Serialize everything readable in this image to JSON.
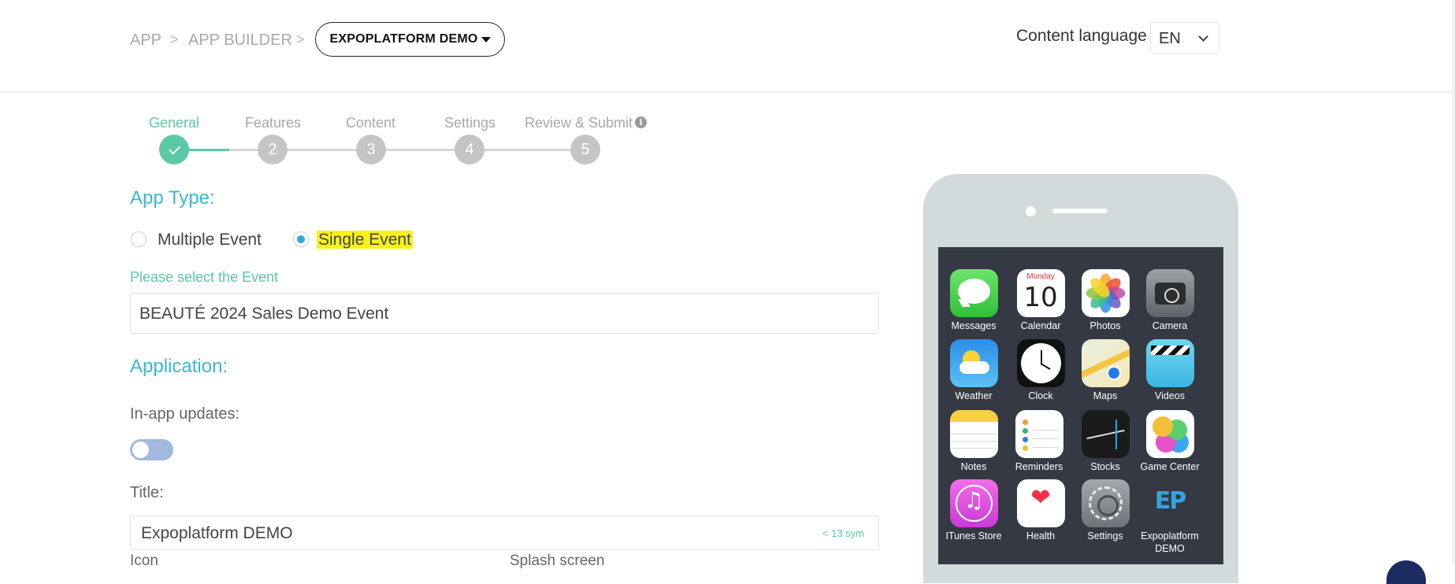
{
  "breadcrumb": {
    "items": [
      "APP",
      "APP BUILDER"
    ],
    "separator": ">",
    "event_selector": "EXPOPLATFORM DEMO"
  },
  "header": {
    "content_language_label": "Content language",
    "language_value": "EN"
  },
  "steps": [
    {
      "label": "General",
      "number": "1",
      "state": "done"
    },
    {
      "label": "Features",
      "number": "2",
      "state": "todo"
    },
    {
      "label": "Content",
      "number": "3",
      "state": "todo"
    },
    {
      "label": "Settings",
      "number": "4",
      "state": "todo"
    },
    {
      "label": "Review & Submit",
      "number": "5",
      "state": "todo"
    }
  ],
  "form": {
    "app_type_title": "App Type:",
    "radio_multiple": "Multiple Event",
    "radio_single": "Single Event",
    "selected_app_type": "Single Event",
    "select_event_label": "Please select the Event",
    "event_value": "BEAUTÉ 2024 Sales Demo Event",
    "application_title": "Application:",
    "inapp_updates_label": "In-app updates:",
    "inapp_updates_enabled": false,
    "title_label": "Title:",
    "title_value": "Expoplatform DEMO",
    "title_counter": "< 13 sym",
    "icon_label": "Icon",
    "splash_label": "Splash screen"
  },
  "phone_preview": {
    "apps": [
      {
        "label": "Messages",
        "icon": "messages-icon"
      },
      {
        "label": "Calendar",
        "icon": "calendar-icon",
        "day": "Monday",
        "date": "10"
      },
      {
        "label": "Photos",
        "icon": "photos-icon"
      },
      {
        "label": "Camera",
        "icon": "camera-icon"
      },
      {
        "label": "Weather",
        "icon": "weather-icon"
      },
      {
        "label": "Clock",
        "icon": "clock-icon"
      },
      {
        "label": "Maps",
        "icon": "maps-icon"
      },
      {
        "label": "Videos",
        "icon": "videos-icon"
      },
      {
        "label": "Notes",
        "icon": "notes-icon"
      },
      {
        "label": "Reminders",
        "icon": "reminders-icon"
      },
      {
        "label": "Stocks",
        "icon": "stocks-icon"
      },
      {
        "label": "Game Center",
        "icon": "game-center-icon"
      },
      {
        "label": "ITunes Store",
        "icon": "itunes-store-icon"
      },
      {
        "label": "Health",
        "icon": "health-icon"
      },
      {
        "label": "Settings",
        "icon": "settings-icon"
      },
      {
        "label": "Expoplatform DEMO",
        "icon": "expoplatform-logo-icon",
        "logo_text": "EP"
      }
    ]
  },
  "colors": {
    "accent_teal": "#5cc8a6",
    "accent_blue": "#3bb7d3",
    "highlight": "#f6f21a"
  }
}
